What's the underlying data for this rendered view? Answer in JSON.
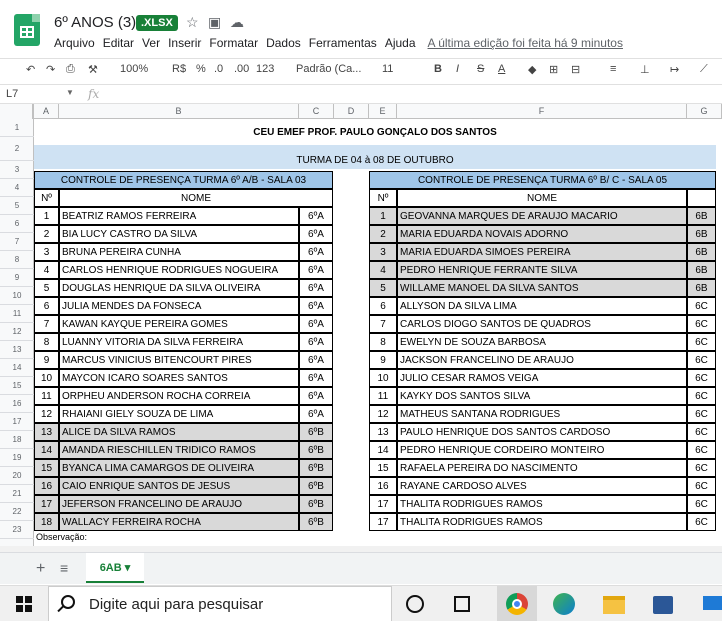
{
  "document": {
    "title": "6º ANOS (3)",
    "badge": ".XLSX",
    "last_edit": "A última edição foi feita há 9 minutos"
  },
  "menu": [
    "Arquivo",
    "Editar",
    "Ver",
    "Inserir",
    "Formatar",
    "Dados",
    "Ferramentas",
    "Ajuda"
  ],
  "toolbar": {
    "zoom": "100%",
    "currency": "R$",
    "percent": "%",
    "dec_decrease": ".0",
    "dec_increase": ".00",
    "more_formats": "123",
    "font": "Padrão (Ca...",
    "font_size": "11",
    "bold": "B",
    "italic": "I",
    "strike": "S",
    "text_color": "A"
  },
  "formula_bar": {
    "cell_ref": "L7",
    "fx": "fx",
    "value": ""
  },
  "columns": [
    "A",
    "B",
    "C",
    "D",
    "E",
    "F",
    "G"
  ],
  "rows": [
    "1",
    "2",
    "3",
    "4",
    "5",
    "6",
    "7",
    "8",
    "9",
    "10",
    "11",
    "12",
    "13",
    "14",
    "15",
    "16",
    "17",
    "18",
    "19",
    "20",
    "21",
    "22",
    "23"
  ],
  "sheet": {
    "title": "CEU EMEF PROF. PAULO GONÇALO DOS SANTOS",
    "subtitle": "TURMA DE 04 à 08 DE OUTUBRO",
    "left_header": "CONTROLE DE PRESENÇA TURMA 6º A/B  -  SALA 03",
    "right_header": "CONTROLE DE PRESENÇA TURMA 6º B/ C  -  SALA 05",
    "col_num": "Nº",
    "col_name": "NOME",
    "observation": "Observação:",
    "left_rows": [
      {
        "n": "1",
        "name": "BEATRIZ RAMOS FERREIRA",
        "cls": "6ºA",
        "gray": false
      },
      {
        "n": "2",
        "name": "BIA LUCY CASTRO DA SILVA",
        "cls": "6ºA",
        "gray": false
      },
      {
        "n": "3",
        "name": "BRUNA PEREIRA CUNHA",
        "cls": "6ºA",
        "gray": false
      },
      {
        "n": "4",
        "name": "CARLOS HENRIQUE RODRIGUES NOGUEIRA",
        "cls": "6ºA",
        "gray": false
      },
      {
        "n": "5",
        "name": "DOUGLAS HENRIQUE DA SILVA OLIVEIRA",
        "cls": "6ºA",
        "gray": false
      },
      {
        "n": "6",
        "name": "JULIA MENDES DA FONSECA",
        "cls": "6ºA",
        "gray": false
      },
      {
        "n": "7",
        "name": "KAWAN KAYQUE PEREIRA GOMES",
        "cls": "6ºA",
        "gray": false
      },
      {
        "n": "8",
        "name": "LUANNY VITORIA DA SILVA FERREIRA",
        "cls": "6ºA",
        "gray": false
      },
      {
        "n": "9",
        "name": "MARCUS VINICIUS BITENCOURT PIRES",
        "cls": "6ºA",
        "gray": false
      },
      {
        "n": "10",
        "name": "MAYCON ICARO SOARES SANTOS",
        "cls": "6ºA",
        "gray": false
      },
      {
        "n": "11",
        "name": "ORPHEU ANDERSON ROCHA CORREIA",
        "cls": "6ºA",
        "gray": false
      },
      {
        "n": "12",
        "name": "RHAIANI GIELY SOUZA DE LIMA",
        "cls": "6ºA",
        "gray": false
      },
      {
        "n": "13",
        "name": "ALICE DA SILVA RAMOS",
        "cls": "6ºB",
        "gray": true
      },
      {
        "n": "14",
        "name": "AMANDA RIESCHILLEN TRIDICO RAMOS",
        "cls": "6ºB",
        "gray": true
      },
      {
        "n": "15",
        "name": "BYANCA LIMA CAMARGOS DE OLIVEIRA",
        "cls": "6ºB",
        "gray": true
      },
      {
        "n": "16",
        "name": "CAIO ENRIQUE SANTOS DE JESUS",
        "cls": "6ºB",
        "gray": true
      },
      {
        "n": "17",
        "name": "JEFERSON FRANCELINO DE ARAUJO",
        "cls": "6ºB",
        "gray": true
      },
      {
        "n": "18",
        "name": "WALLACY FERREIRA ROCHA",
        "cls": "6ºB",
        "gray": true
      }
    ],
    "right_rows": [
      {
        "n": "1",
        "name": "GEOVANNA MARQUES DE ARAUJO MACARIO",
        "cls": "6B",
        "gray": true
      },
      {
        "n": "2",
        "name": "MARIA EDUARDA NOVAIS ADORNO",
        "cls": "6B",
        "gray": true
      },
      {
        "n": "3",
        "name": "MARIA EDUARDA SIMOES PEREIRA",
        "cls": "6B",
        "gray": true
      },
      {
        "n": "4",
        "name": "PEDRO HENRIQUE FERRANTE SILVA",
        "cls": "6B",
        "gray": true
      },
      {
        "n": "5",
        "name": "WILLAME MANOEL DA SILVA SANTOS",
        "cls": "6B",
        "gray": true
      },
      {
        "n": "6",
        "name": "ALLYSON DA SILVA LIMA",
        "cls": "6C",
        "gray": false
      },
      {
        "n": "7",
        "name": "CARLOS DIOGO SANTOS DE QUADROS",
        "cls": "6C",
        "gray": false
      },
      {
        "n": "8",
        "name": "EWELYN DE SOUZA BARBOSA",
        "cls": "6C",
        "gray": false
      },
      {
        "n": "9",
        "name": "JACKSON FRANCELINO DE ARAUJO",
        "cls": "6C",
        "gray": false
      },
      {
        "n": "10",
        "name": "JULIO CESAR RAMOS VEIGA",
        "cls": "6C",
        "gray": false
      },
      {
        "n": "11",
        "name": "KAYKY DOS SANTOS SILVA",
        "cls": "6C",
        "gray": false
      },
      {
        "n": "12",
        "name": "MATHEUS SANTANA RODRIGUES",
        "cls": "6C",
        "gray": false
      },
      {
        "n": "13",
        "name": "PAULO HENRIQUE DOS SANTOS CARDOSO",
        "cls": "6C",
        "gray": false
      },
      {
        "n": "14",
        "name": "PEDRO HENRIQUE CORDEIRO MONTEIRO",
        "cls": "6C",
        "gray": false
      },
      {
        "n": "15",
        "name": "RAFAELA PEREIRA DO NASCIMENTO",
        "cls": "6C",
        "gray": false
      },
      {
        "n": "16",
        "name": "RAYANE CARDOSO ALVES",
        "cls": "6C",
        "gray": false
      },
      {
        "n": "17",
        "name": "THALITA RODRIGUES RAMOS",
        "cls": "6C",
        "gray": false
      },
      {
        "n": "17",
        "name": "THALITA RODRIGUES RAMOS",
        "cls": "6C",
        "gray": false
      }
    ]
  },
  "sheet_tab": {
    "label": "6AB",
    "caret": "▾"
  },
  "taskbar": {
    "search_placeholder": "Digite aqui para pesquisar"
  },
  "colors": {
    "accent": "#188038",
    "header_blue": "#cfe2f3",
    "subheader_blue": "#9fc5e8",
    "gray_row": "#d9d9d9"
  }
}
